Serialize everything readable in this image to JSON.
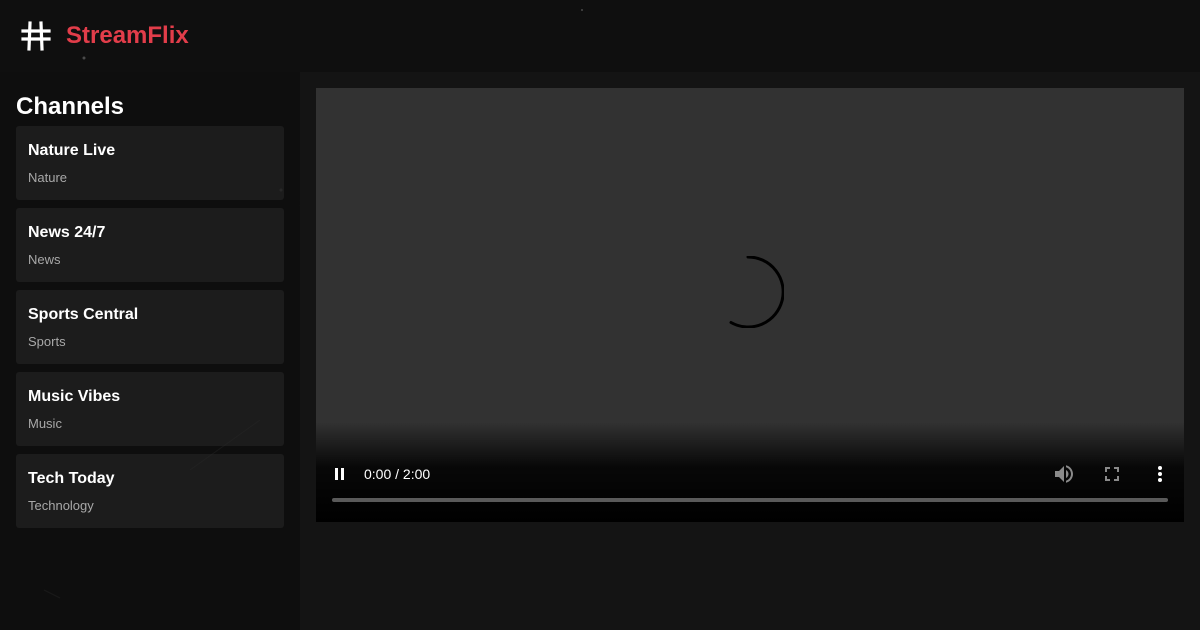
{
  "app": {
    "brand": "StreamFlix",
    "logo_icon": "hash-icon",
    "brand_color": "#e23d4a"
  },
  "sidebar": {
    "title": "Channels",
    "channels": [
      {
        "name": "Nature Live",
        "category": "Nature"
      },
      {
        "name": "News 24/7",
        "category": "News"
      },
      {
        "name": "Sports Central",
        "category": "Sports"
      },
      {
        "name": "Music Vibes",
        "category": "Music"
      },
      {
        "name": "Tech Today",
        "category": "Technology"
      }
    ]
  },
  "player": {
    "state": "loading",
    "time_display": "0:00 / 2:00",
    "progress": 0,
    "controls": {
      "play_pause_icon": "pause-icon",
      "volume_icon": "volume-icon",
      "fullscreen_icon": "fullscreen-icon",
      "more_icon": "more-vertical-icon"
    }
  }
}
